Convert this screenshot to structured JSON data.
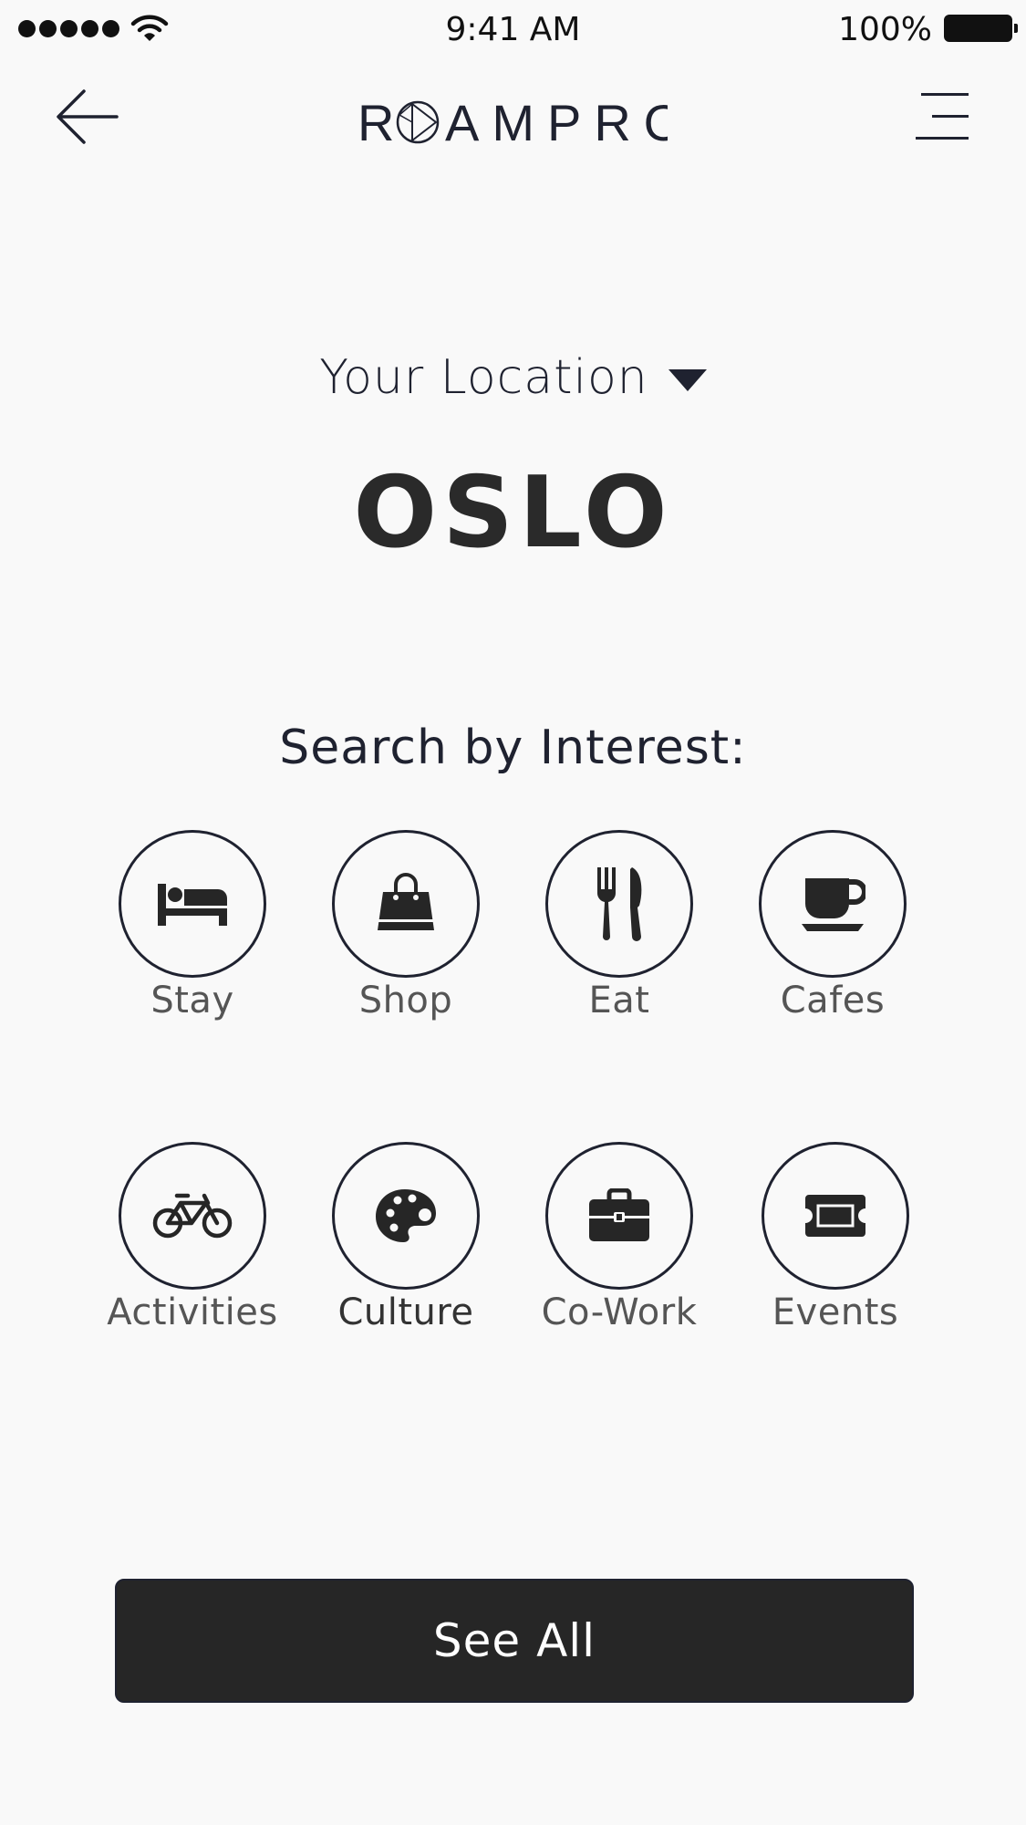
{
  "status_bar": {
    "time": "9:41 AM",
    "battery": "100%"
  },
  "header": {
    "logo": "ROAMPRO",
    "back_icon": "arrow-left-icon",
    "menu_icon": "menu-icon"
  },
  "location": {
    "label": "Your Location",
    "city": "OSLO"
  },
  "interests": {
    "title": "Search by Interest:",
    "items": [
      {
        "label": "Stay",
        "icon": "bed-icon"
      },
      {
        "label": "Shop",
        "icon": "shopping-bag-icon"
      },
      {
        "label": "Eat",
        "icon": "fork-knife-icon"
      },
      {
        "label": "Cafes",
        "icon": "coffee-cup-icon"
      },
      {
        "label": "Activities",
        "icon": "bicycle-icon"
      },
      {
        "label": "Culture",
        "icon": "palette-icon"
      },
      {
        "label": "Co-Work",
        "icon": "briefcase-icon"
      },
      {
        "label": "Events",
        "icon": "ticket-icon"
      }
    ]
  },
  "see_all": {
    "label": "See All"
  },
  "colors": {
    "text": "#1f2230",
    "button_bg": "#262626",
    "background": "#f9f9f9"
  }
}
